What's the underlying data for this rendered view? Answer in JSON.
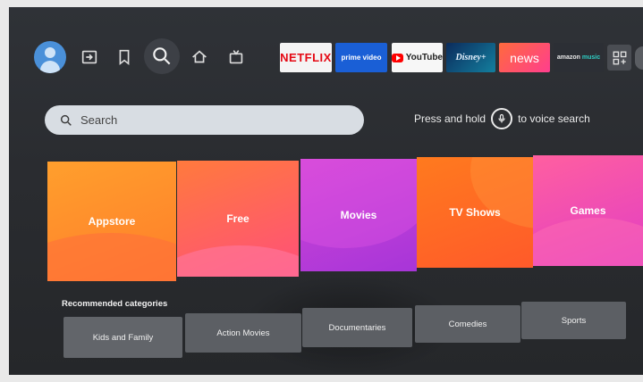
{
  "nav": {
    "icons": [
      "profile-avatar",
      "input-icon",
      "bookmark-icon",
      "search-icon",
      "home-icon",
      "live-tv-icon"
    ]
  },
  "apps": {
    "netflix": "NETFLIX",
    "prime": "prime video",
    "youtube": "YouTube",
    "disney": "Disney+",
    "news": "news",
    "music_brand": "amazon",
    "music_word": "music"
  },
  "search": {
    "placeholder": "Search",
    "voice_before": "Press and hold",
    "voice_after": "to voice search"
  },
  "tiles": [
    "Appstore",
    "Free",
    "Movies",
    "TV Shows",
    "Games"
  ],
  "recommended": {
    "title": "Recommended categories",
    "items": [
      "Kids and Family",
      "Action Movies",
      "Documentaries",
      "Comedies",
      "Sports"
    ]
  },
  "colors": {
    "accent_search": "#d8dde3",
    "tile_appstore": "#ff9f2d",
    "tile_free": "#ff5f6a",
    "tile_movies": "#c23ed8",
    "tile_tv_shows": "#ff6a22",
    "tile_games": "#f04cb2"
  }
}
